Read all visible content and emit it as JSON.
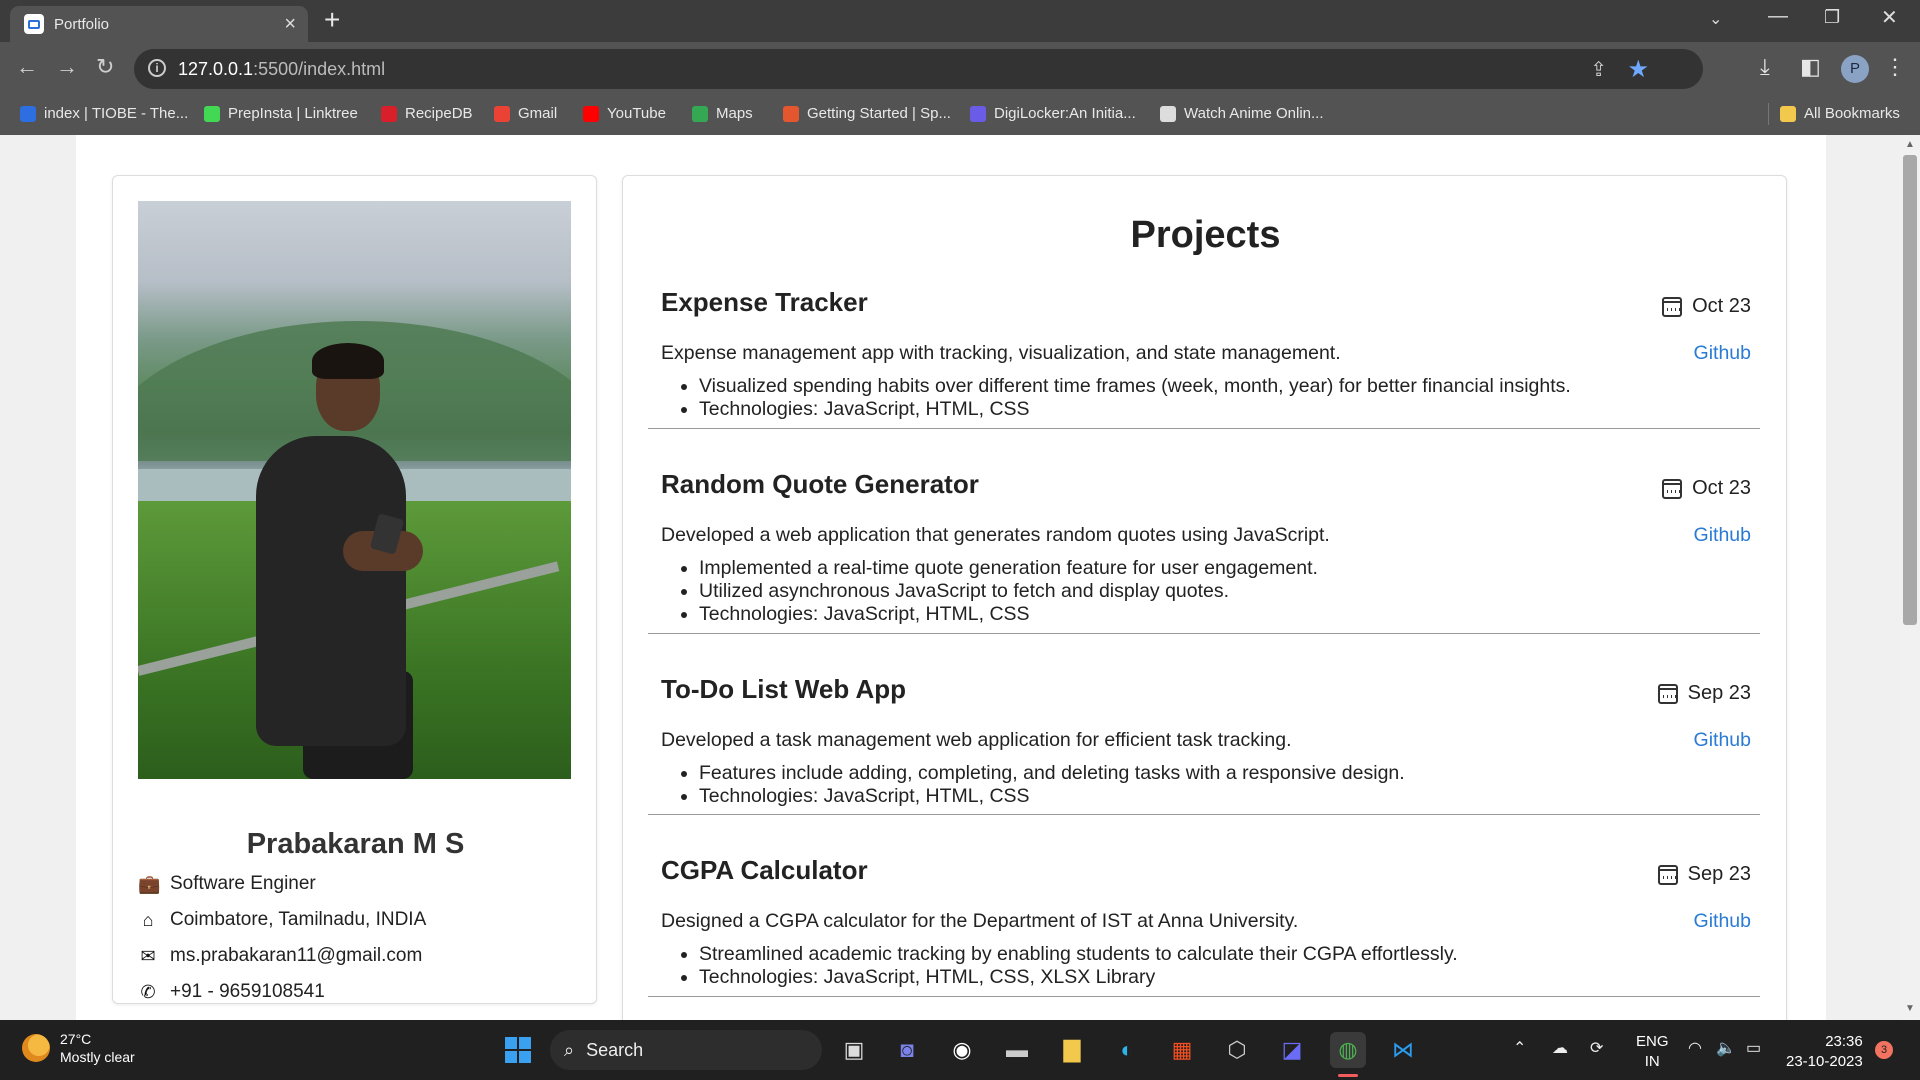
{
  "browser": {
    "tab_title": "Portfolio",
    "url_host": "127.0.0.1",
    "url_path": ":5500/index.html",
    "profile_initial": "P",
    "bookmarks": [
      {
        "label": "index | TIOBE - The...",
        "color": "#2d6fe0"
      },
      {
        "label": "PrepInsta | Linktree",
        "color": "#43d854"
      },
      {
        "label": "RecipeDB",
        "color": "#d81f2a"
      },
      {
        "label": "Gmail",
        "color": "#ea4335"
      },
      {
        "label": "YouTube",
        "color": "#ff0000"
      },
      {
        "label": "Maps",
        "color": "#34a853"
      },
      {
        "label": "Getting Started | Sp...",
        "color": "#e4572e"
      },
      {
        "label": "DigiLocker:An Initia...",
        "color": "#6b5ce7"
      },
      {
        "label": "Watch Anime Onlin...",
        "color": "#dddddd"
      }
    ],
    "all_bookmarks_label": "All Bookmarks"
  },
  "profile": {
    "name": "Prabakaran M S",
    "role": "Software Enginer",
    "location": "Coimbatore, Tamilnadu, INDIA",
    "email": "ms.prabakaran11@gmail.com",
    "phone": "+91 - 9659108541"
  },
  "projects_section": {
    "title": "Projects",
    "items": [
      {
        "title": "Expense Tracker",
        "date": "Oct 23",
        "description": "Expense management app with tracking, visualization, and state management.",
        "link_label": "Github",
        "bullets": [
          "Visualized spending habits over different time frames (week, month, year) for better financial insights.",
          "Technologies: JavaScript, HTML, CSS"
        ]
      },
      {
        "title": "Random Quote Generator",
        "date": "Oct 23",
        "description": "Developed a web application that generates random quotes using JavaScript.",
        "link_label": "Github",
        "bullets": [
          "Implemented a real-time quote generation feature for user engagement.",
          "Utilized asynchronous JavaScript to fetch and display quotes.",
          "Technologies: JavaScript, HTML, CSS"
        ]
      },
      {
        "title": "To-Do List Web App",
        "date": "Sep 23",
        "description": "Developed a task management web application for efficient task tracking.",
        "link_label": "Github",
        "bullets": [
          "Features include adding, completing, and deleting tasks with a responsive design.",
          "Technologies: JavaScript, HTML, CSS"
        ]
      },
      {
        "title": "CGPA Calculator",
        "date": "Sep 23",
        "description": "Designed a CGPA calculator for the Department of IST at Anna University.",
        "link_label": "Github",
        "bullets": [
          "Streamlined academic tracking by enabling students to calculate their CGPA effortlessly.",
          "Technologies: JavaScript, HTML, CSS, XLSX Library"
        ]
      }
    ]
  },
  "taskbar": {
    "temperature": "27°C",
    "weather": "Mostly clear",
    "search_label": "Search",
    "lang_1": "ENG",
    "lang_2": "IN",
    "time": "23:36",
    "date": "23-10-2023",
    "notification_count": "3"
  }
}
